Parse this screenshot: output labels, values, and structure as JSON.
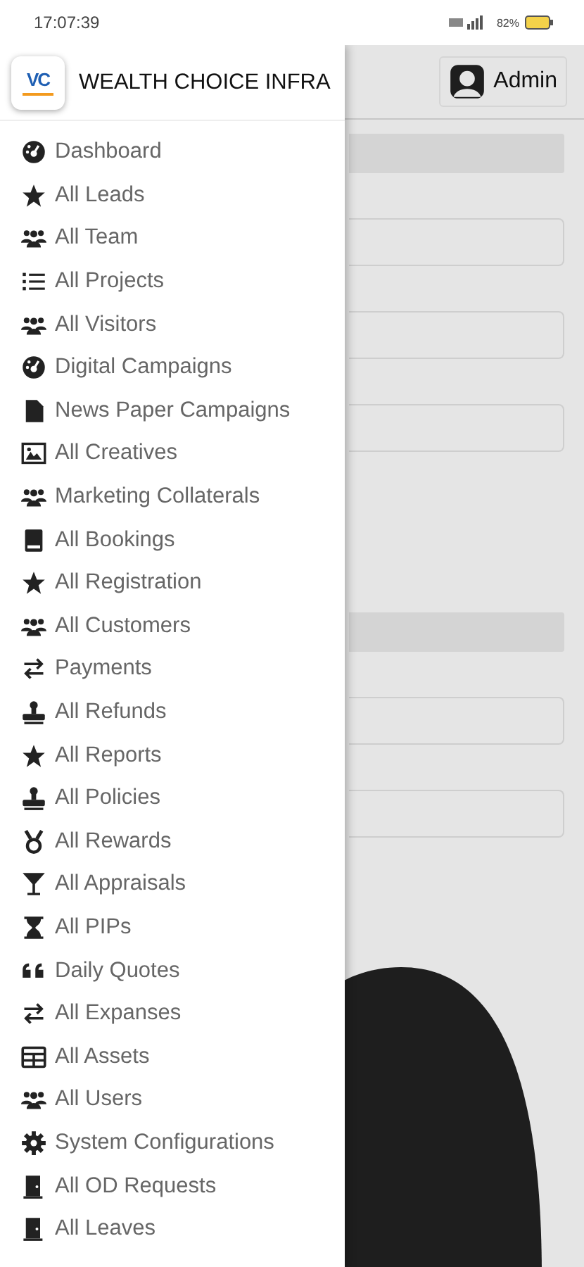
{
  "status_bar": {
    "time": "17:07:39",
    "battery": "82%"
  },
  "drawer": {
    "title": "WEALTH CHOICE INFRA",
    "logo": "VC",
    "items": [
      {
        "label": "Dashboard"
      },
      {
        "label": "All Leads"
      },
      {
        "label": "All Team"
      },
      {
        "label": "All Projects"
      },
      {
        "label": "All Visitors"
      },
      {
        "label": "Digital Campaigns"
      },
      {
        "label": "News Paper Campaigns"
      },
      {
        "label": "All Creatives"
      },
      {
        "label": "Marketing Collaterals"
      },
      {
        "label": "All Bookings"
      },
      {
        "label": "All Registration"
      },
      {
        "label": "All Customers"
      },
      {
        "label": "Payments"
      },
      {
        "label": "All Refunds"
      },
      {
        "label": "All Reports"
      },
      {
        "label": "All Policies"
      },
      {
        "label": "All Rewards"
      },
      {
        "label": "All Appraisals"
      },
      {
        "label": "All PIPs"
      },
      {
        "label": "Daily Quotes"
      },
      {
        "label": "All Expanses"
      },
      {
        "label": "All Assets"
      },
      {
        "label": "All Users"
      },
      {
        "label": "System Configurations"
      },
      {
        "label": "All OD Requests"
      },
      {
        "label": "All Leaves"
      }
    ]
  },
  "header": {
    "user": "Admin"
  }
}
